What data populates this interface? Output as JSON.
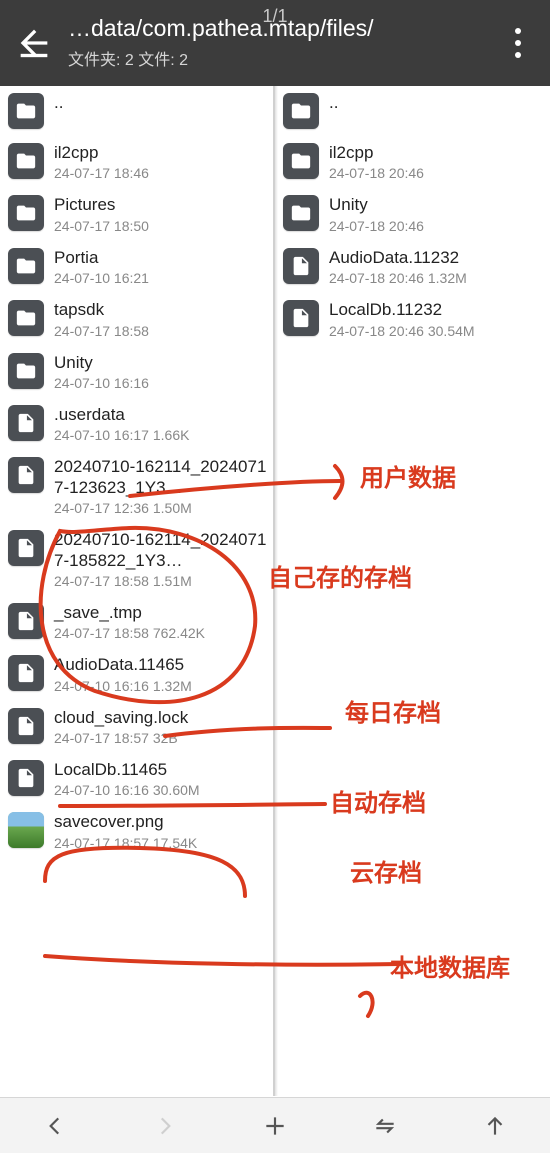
{
  "header": {
    "center": "1/1",
    "path": "…data/com.pathea.mtap/files/",
    "count": "文件夹: 2  文件: 2"
  },
  "left": {
    "up": "..",
    "items": [
      {
        "type": "folder",
        "name": "il2cpp",
        "meta": "24-07-17 18:46"
      },
      {
        "type": "folder",
        "name": "Pictures",
        "meta": "24-07-17 18:50"
      },
      {
        "type": "folder",
        "name": "Portia",
        "meta": "24-07-10 16:21"
      },
      {
        "type": "folder",
        "name": "tapsdk",
        "meta": "24-07-17 18:58"
      },
      {
        "type": "folder",
        "name": "Unity",
        "meta": "24-07-10 16:16"
      },
      {
        "type": "file",
        "name": ".userdata",
        "meta": "24-07-10 16:17  1.66K"
      },
      {
        "type": "file",
        "name": "20240710-162114_20240717-123623_1Y3…",
        "meta": "24-07-17 12:36  1.50M"
      },
      {
        "type": "file",
        "name": "20240710-162114_20240717-185822_1Y3…",
        "meta": "24-07-17 18:58  1.51M"
      },
      {
        "type": "file",
        "name": "_save_.tmp",
        "meta": "24-07-17 18:58  762.42K"
      },
      {
        "type": "file",
        "name": "AudioData.11465",
        "meta": "24-07-10 16:16  1.32M"
      },
      {
        "type": "file",
        "name": "cloud_saving.lock",
        "meta": "24-07-17 18:57  32B"
      },
      {
        "type": "file",
        "name": "LocalDb.11465",
        "meta": "24-07-10 16:16  30.60M"
      },
      {
        "type": "thumb",
        "name": "savecover.png",
        "meta": "24-07-17 18:57  17.54K"
      }
    ]
  },
  "right": {
    "up": "..",
    "items": [
      {
        "type": "folder",
        "name": "il2cpp",
        "meta": "24-07-18 20:46"
      },
      {
        "type": "folder",
        "name": "Unity",
        "meta": "24-07-18 20:46"
      },
      {
        "type": "file",
        "name": "AudioData.11232",
        "meta": "24-07-18 20:46  1.32M"
      },
      {
        "type": "file",
        "name": "LocalDb.11232",
        "meta": "24-07-18 20:46  30.54M"
      }
    ]
  },
  "annotations": {
    "a1": "用户数据",
    "a2": "自己存的存档",
    "a3": "每日存档",
    "a4": "自动存档",
    "a5": "云存档",
    "a6": "本地数据库"
  }
}
